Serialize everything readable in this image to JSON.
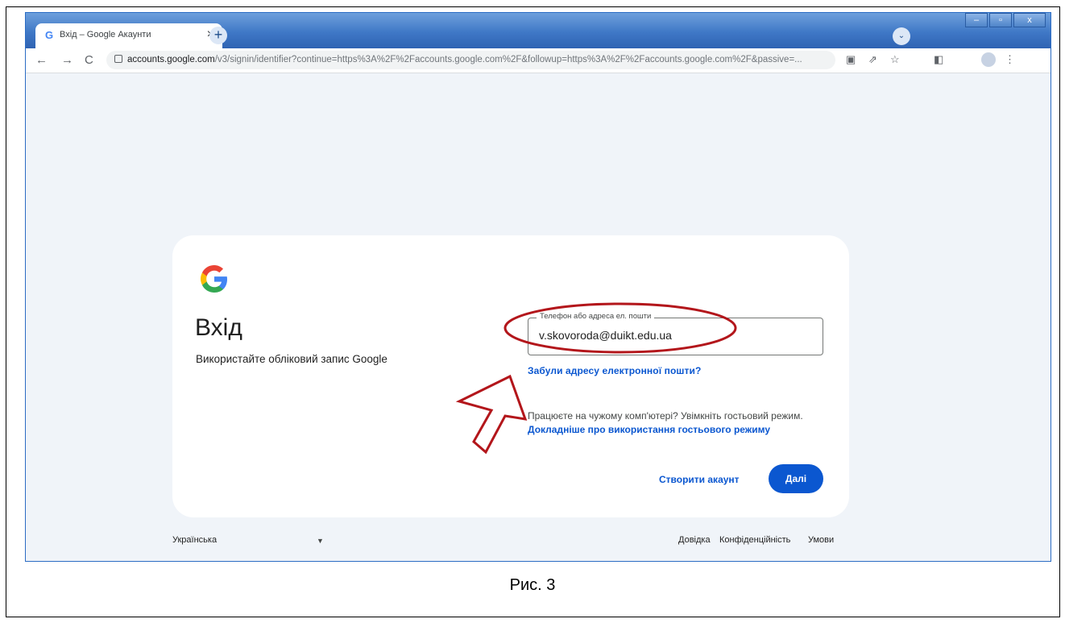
{
  "browser": {
    "tab_title": "Вхід – Google Акаунти",
    "tab_favicon": "G",
    "url_domain": "accounts.google.com",
    "url_path": "/v3/signin/identifier?continue=https%3A%2F%2Faccounts.google.com%2F&followup=https%3A%2F%2Faccounts.google.com%2F&passive=..."
  },
  "signin": {
    "logo": "G",
    "heading": "Вхід",
    "subtitle": "Використайте обліковий запис Google",
    "email_label": "Телефон або адреса ел. пошти",
    "email_value": "v.skovoroda@duikt.edu.ua",
    "forgot_email": "Забули адресу електронної пошти?",
    "guest_text": "Працюєте на чужому комп'ютері? Увімкніть гостьовий режим.",
    "guest_link": "Докладніше про використання гостьового режиму",
    "create_account": "Створити акаунт",
    "next": "Далі"
  },
  "footer": {
    "language": "Українська",
    "help": "Довідка",
    "privacy": "Конфіденційність",
    "terms": "Умови"
  },
  "caption": "Рис. 3",
  "colors": {
    "accent": "#0b57d0",
    "annotation": "#b3161b",
    "page_bg": "#f0f4f9"
  }
}
